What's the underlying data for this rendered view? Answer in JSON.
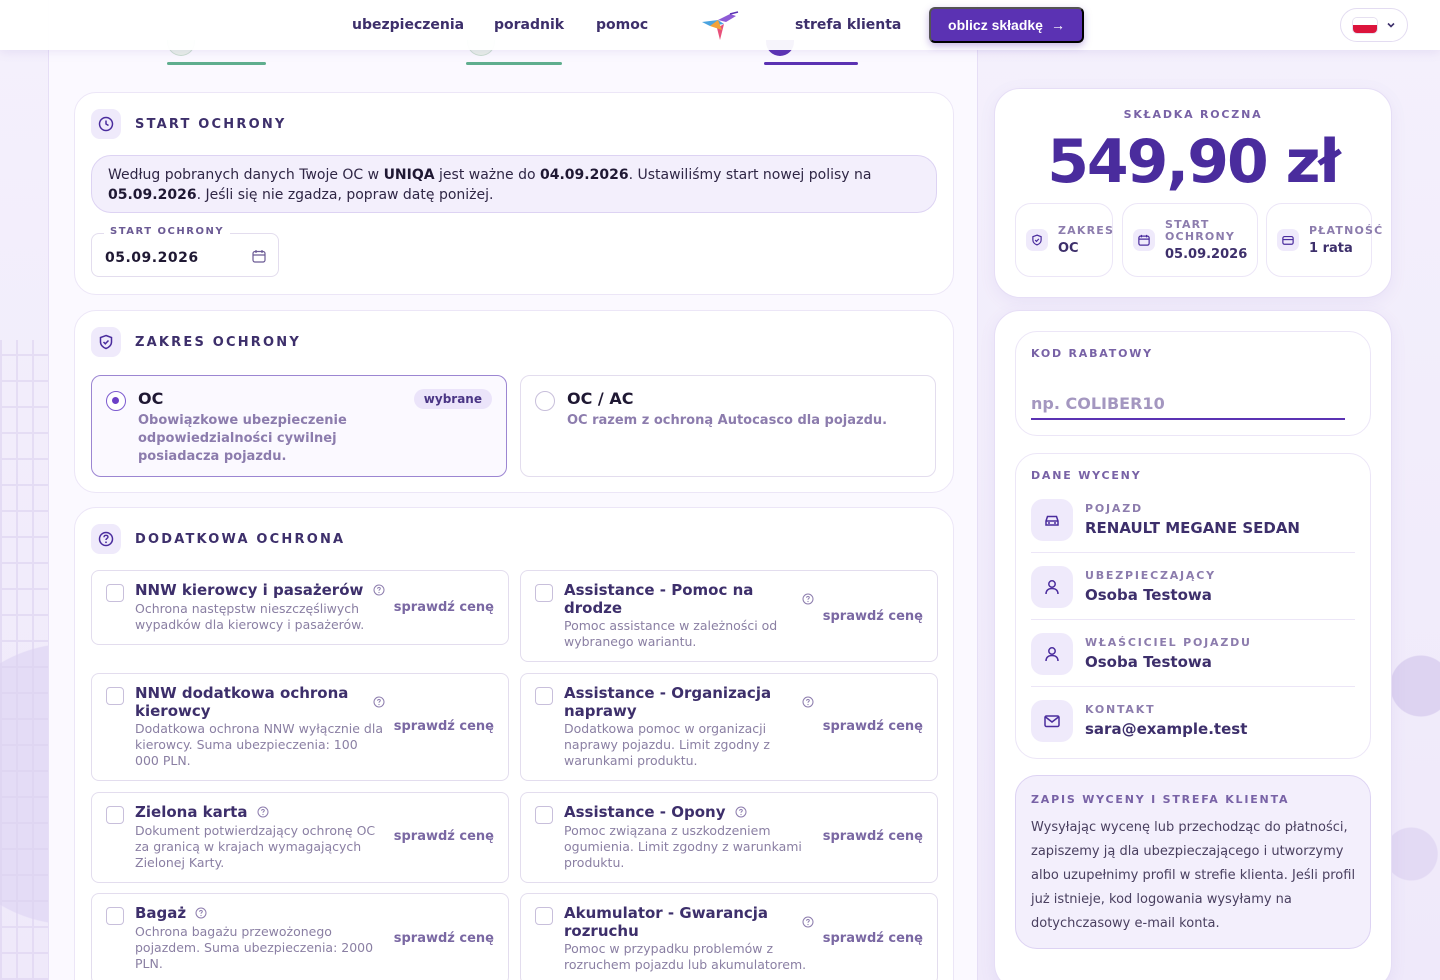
{
  "nav": {
    "links": [
      "ubezpieczenia",
      "poradnik",
      "pomoc"
    ],
    "client_zone": "strefa klienta",
    "cta_label": "oblicz składkę",
    "arrow": "→"
  },
  "start": {
    "title": "START OCHRONY",
    "info_parts": {
      "p1": "Według pobranych danych Twoje OC w ",
      "insurer": "UNIQA",
      "p2": " jest ważne do ",
      "end_date": "04.09.2026",
      "p3": ". Ustawiliśmy start nowej polisy na ",
      "start_date": "05.09.2026",
      "p4": ". Jeśli się nie zgadza, popraw datę poniżej."
    },
    "field_label": "START OCHRONY",
    "field_value": "05.09.2026"
  },
  "scope": {
    "title": "ZAKRES OCHRONY",
    "options": [
      {
        "title": "OC",
        "desc": "Obowiązkowe ubezpieczenie odpowiedzialności cywilnej posiadacza pojazdu.",
        "badge": "wybrane",
        "selected": true
      },
      {
        "title": "OC / AC",
        "desc": "OC razem z ochroną Autocasco dla pojazdu.",
        "badge": "",
        "selected": false
      }
    ]
  },
  "addons": {
    "title": "DODATKOWA OCHRONA",
    "price_label": "sprawdź cenę",
    "items": [
      {
        "title": "NNW kierowcy i pasażerów",
        "desc": "Ochrona następstw nieszczęśliwych wypadków dla kierowcy i pasażerów."
      },
      {
        "title": "Assistance - Pomoc na drodze",
        "desc": "Pomoc assistance w zależności od wybranego wariantu."
      },
      {
        "title": "NNW dodatkowa ochrona kierowcy",
        "desc": "Dodatkowa ochrona NNW wyłącznie dla kierowcy. Suma ubezpieczenia: 100 000 PLN."
      },
      {
        "title": "Assistance - Organizacja naprawy",
        "desc": "Dodatkowa pomoc w organizacji naprawy pojazdu. Limit zgodny z warunkami produktu."
      },
      {
        "title": "Zielona karta",
        "desc": "Dokument potwierdzający ochronę OC za granicą w krajach wymagających Zielonej Karty."
      },
      {
        "title": "Assistance - Opony",
        "desc": "Pomoc związana z uszkodzeniem ogumienia. Limit zgodny z warunkami produktu."
      },
      {
        "title": "Bagaż",
        "desc": "Ochrona bagażu przewożonego pojazdem. Suma ubezpieczenia: 2000 PLN."
      },
      {
        "title": "Akumulator - Gwarancja rozruchu",
        "desc": "Pomoc w przypadku problemów z rozruchem pojazdu lub akumulatorem."
      }
    ]
  },
  "summary": {
    "label": "SKŁADKA ROCZNA",
    "value": "549,90 zł",
    "pills": [
      {
        "label": "ZAKRES",
        "value": "OC",
        "icon": "shield-icon"
      },
      {
        "label": "START OCHRONY",
        "value": "05.09.2026",
        "icon": "calendar-icon"
      },
      {
        "label": "PŁATNOŚĆ",
        "value": "1 rata",
        "icon": "card-icon"
      }
    ]
  },
  "promo": {
    "label": "KOD RABATOWY",
    "placeholder": "np. COLIBER10"
  },
  "quote": {
    "label": "DANE WYCENY",
    "rows": [
      {
        "label": "POJAZD",
        "value": "RENAULT MEGANE SEDAN",
        "icon": "car-icon"
      },
      {
        "label": "UBEZPIECZAJĄCY",
        "value": "Osoba Testowa",
        "icon": "user-icon"
      },
      {
        "label": "WŁAŚCICIEL POJAZDU",
        "value": "Osoba Testowa",
        "icon": "user-icon"
      },
      {
        "label": "KONTAKT",
        "value": "sara@example.test",
        "icon": "mail-icon"
      }
    ]
  },
  "notice": {
    "label": "ZAPIS WYCENY I STREFA KLIENTA",
    "text": "Wysyłając wycenę lub przechodząc do płatności, zapiszemy ją dla ubezpieczającego i utworzymy albo uzupełnimy profil w strefie klienta. Jeśli profil już istnieje, kod logowania wysyłamy na dotychczasowy e-mail konta."
  },
  "colors": {
    "accent": "#5b32b3",
    "step_done": "#5fae8e",
    "step_active": "#5b32b3"
  }
}
